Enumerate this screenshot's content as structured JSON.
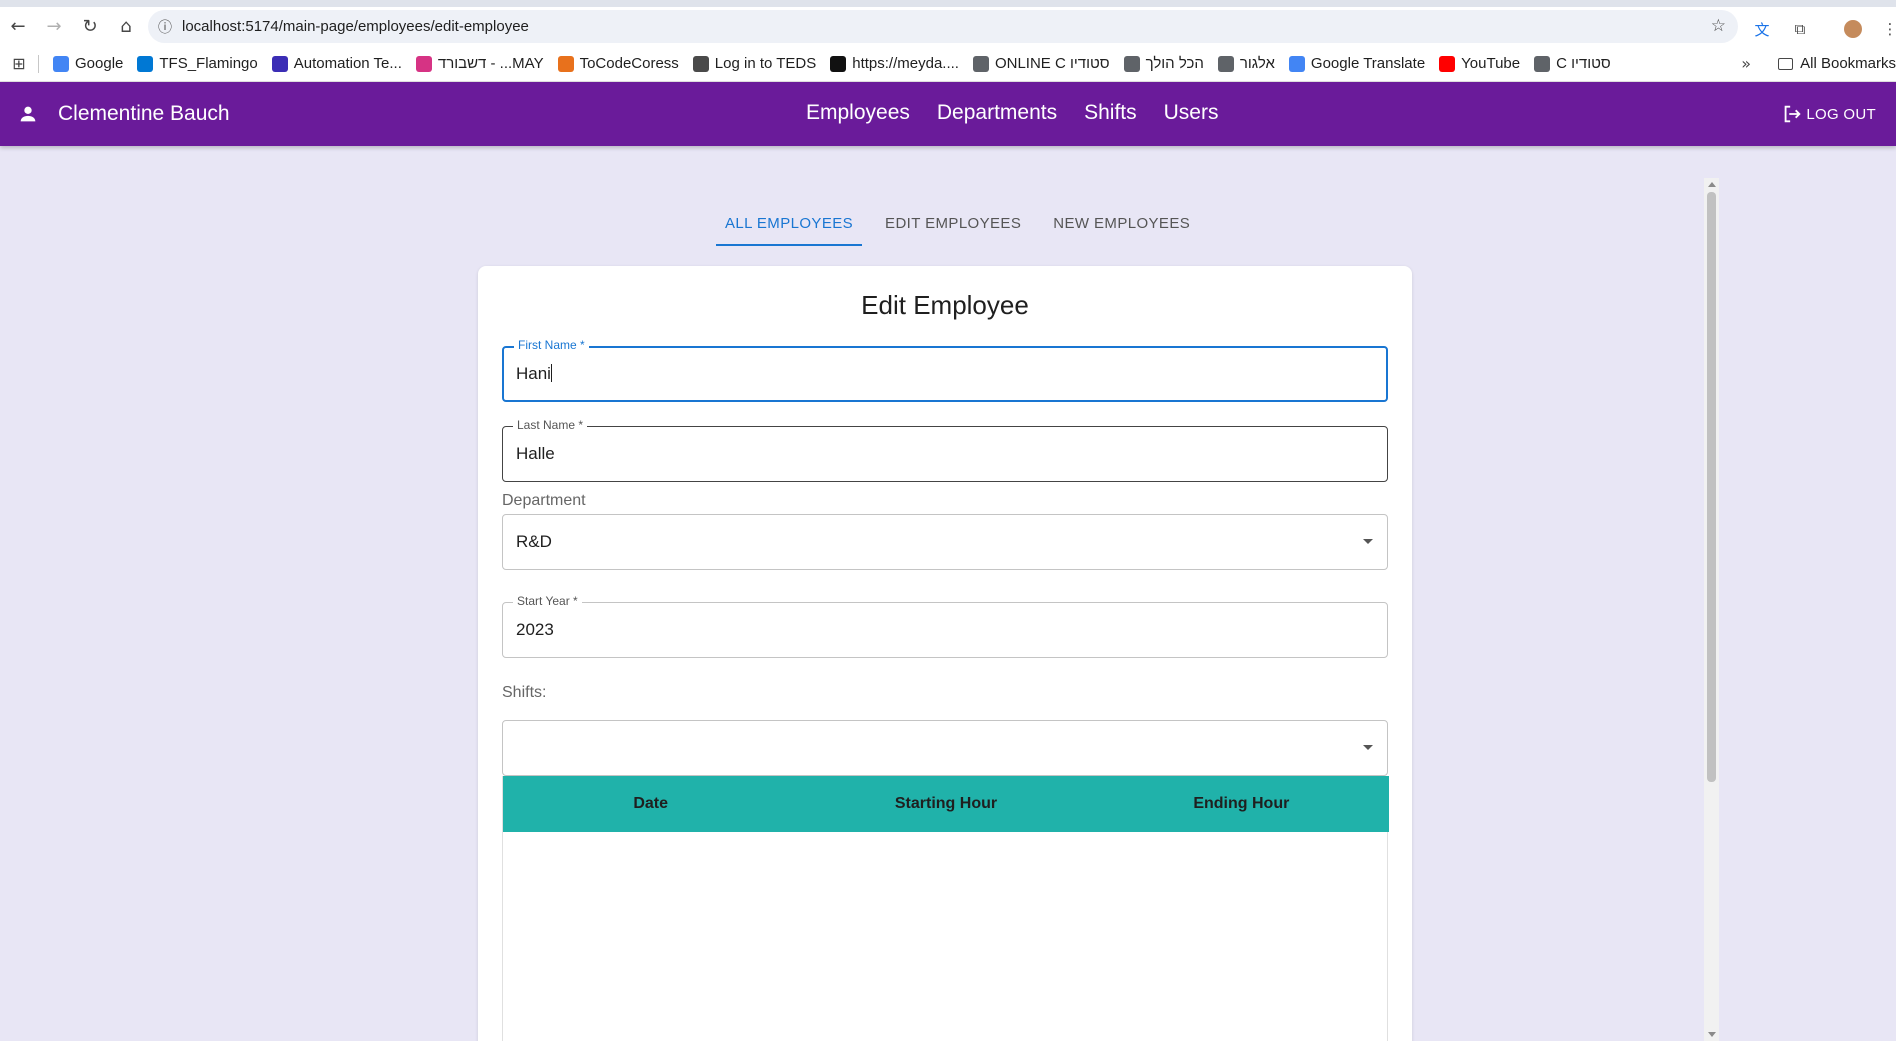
{
  "browser": {
    "url": "localhost:5174/main-page/employees/edit-employee",
    "bookmarks": [
      {
        "label": "Google",
        "icon": "google-icon",
        "color": "#4285f4"
      },
      {
        "label": "TFS_Flamingo",
        "icon": "azure-devops-icon",
        "color": "#0078d4"
      },
      {
        "label": "Automation Te...",
        "icon": "p-logo-icon",
        "color": "#3b2db5"
      },
      {
        "label": "דשבורד - ...MAY",
        "icon": "heart-logo-icon",
        "color": "#d63384"
      },
      {
        "label": "ToCodeCoress",
        "icon": "tocode-icon",
        "color": "#e8711c"
      },
      {
        "label": "Log in to TEDS",
        "icon": "teds-icon",
        "color": "#4a4a4a"
      },
      {
        "label": "https://meyda....",
        "icon": "meyda-icon",
        "color": "#111111"
      },
      {
        "label": "ONLINE C סטודיו",
        "icon": "globe-icon",
        "color": "#5f6368"
      },
      {
        "label": "הכל הולך",
        "icon": "globe-icon",
        "color": "#5f6368"
      },
      {
        "label": "אלגור",
        "icon": "globe-icon",
        "color": "#5f6368"
      },
      {
        "label": "Google Translate",
        "icon": "translate-icon",
        "color": "#4285f4"
      },
      {
        "label": "YouTube",
        "icon": "youtube-icon",
        "color": "#ff0000"
      },
      {
        "label": "C סטודיו",
        "icon": "globe-icon",
        "color": "#5f6368"
      }
    ],
    "all_bookmarks_label": "All Bookmarks"
  },
  "appbar": {
    "user_name": "Clementine Bauch",
    "nav": [
      "Employees",
      "Departments",
      "Shifts",
      "Users"
    ],
    "logout_label": "LOG OUT",
    "color": "#6a1b9a"
  },
  "tabs": [
    {
      "label": "ALL EMPLOYEES",
      "active": true
    },
    {
      "label": "EDIT EMPLOYEES",
      "active": false
    },
    {
      "label": "NEW EMPLOYEES",
      "active": false
    }
  ],
  "form": {
    "title": "Edit Employee",
    "first_name": {
      "label": "First Name *",
      "value": "Hani"
    },
    "last_name": {
      "label": "Last Name *",
      "value": "Halle"
    },
    "department": {
      "label": "Department",
      "value": "R&D"
    },
    "start_year": {
      "label": "Start Year *",
      "value": "2023"
    },
    "shifts_label": "Shifts:",
    "shifts_value": "",
    "table_headers": [
      "Date",
      "Starting Hour",
      "Ending Hour"
    ],
    "table_header_color": "#20b2aa"
  }
}
